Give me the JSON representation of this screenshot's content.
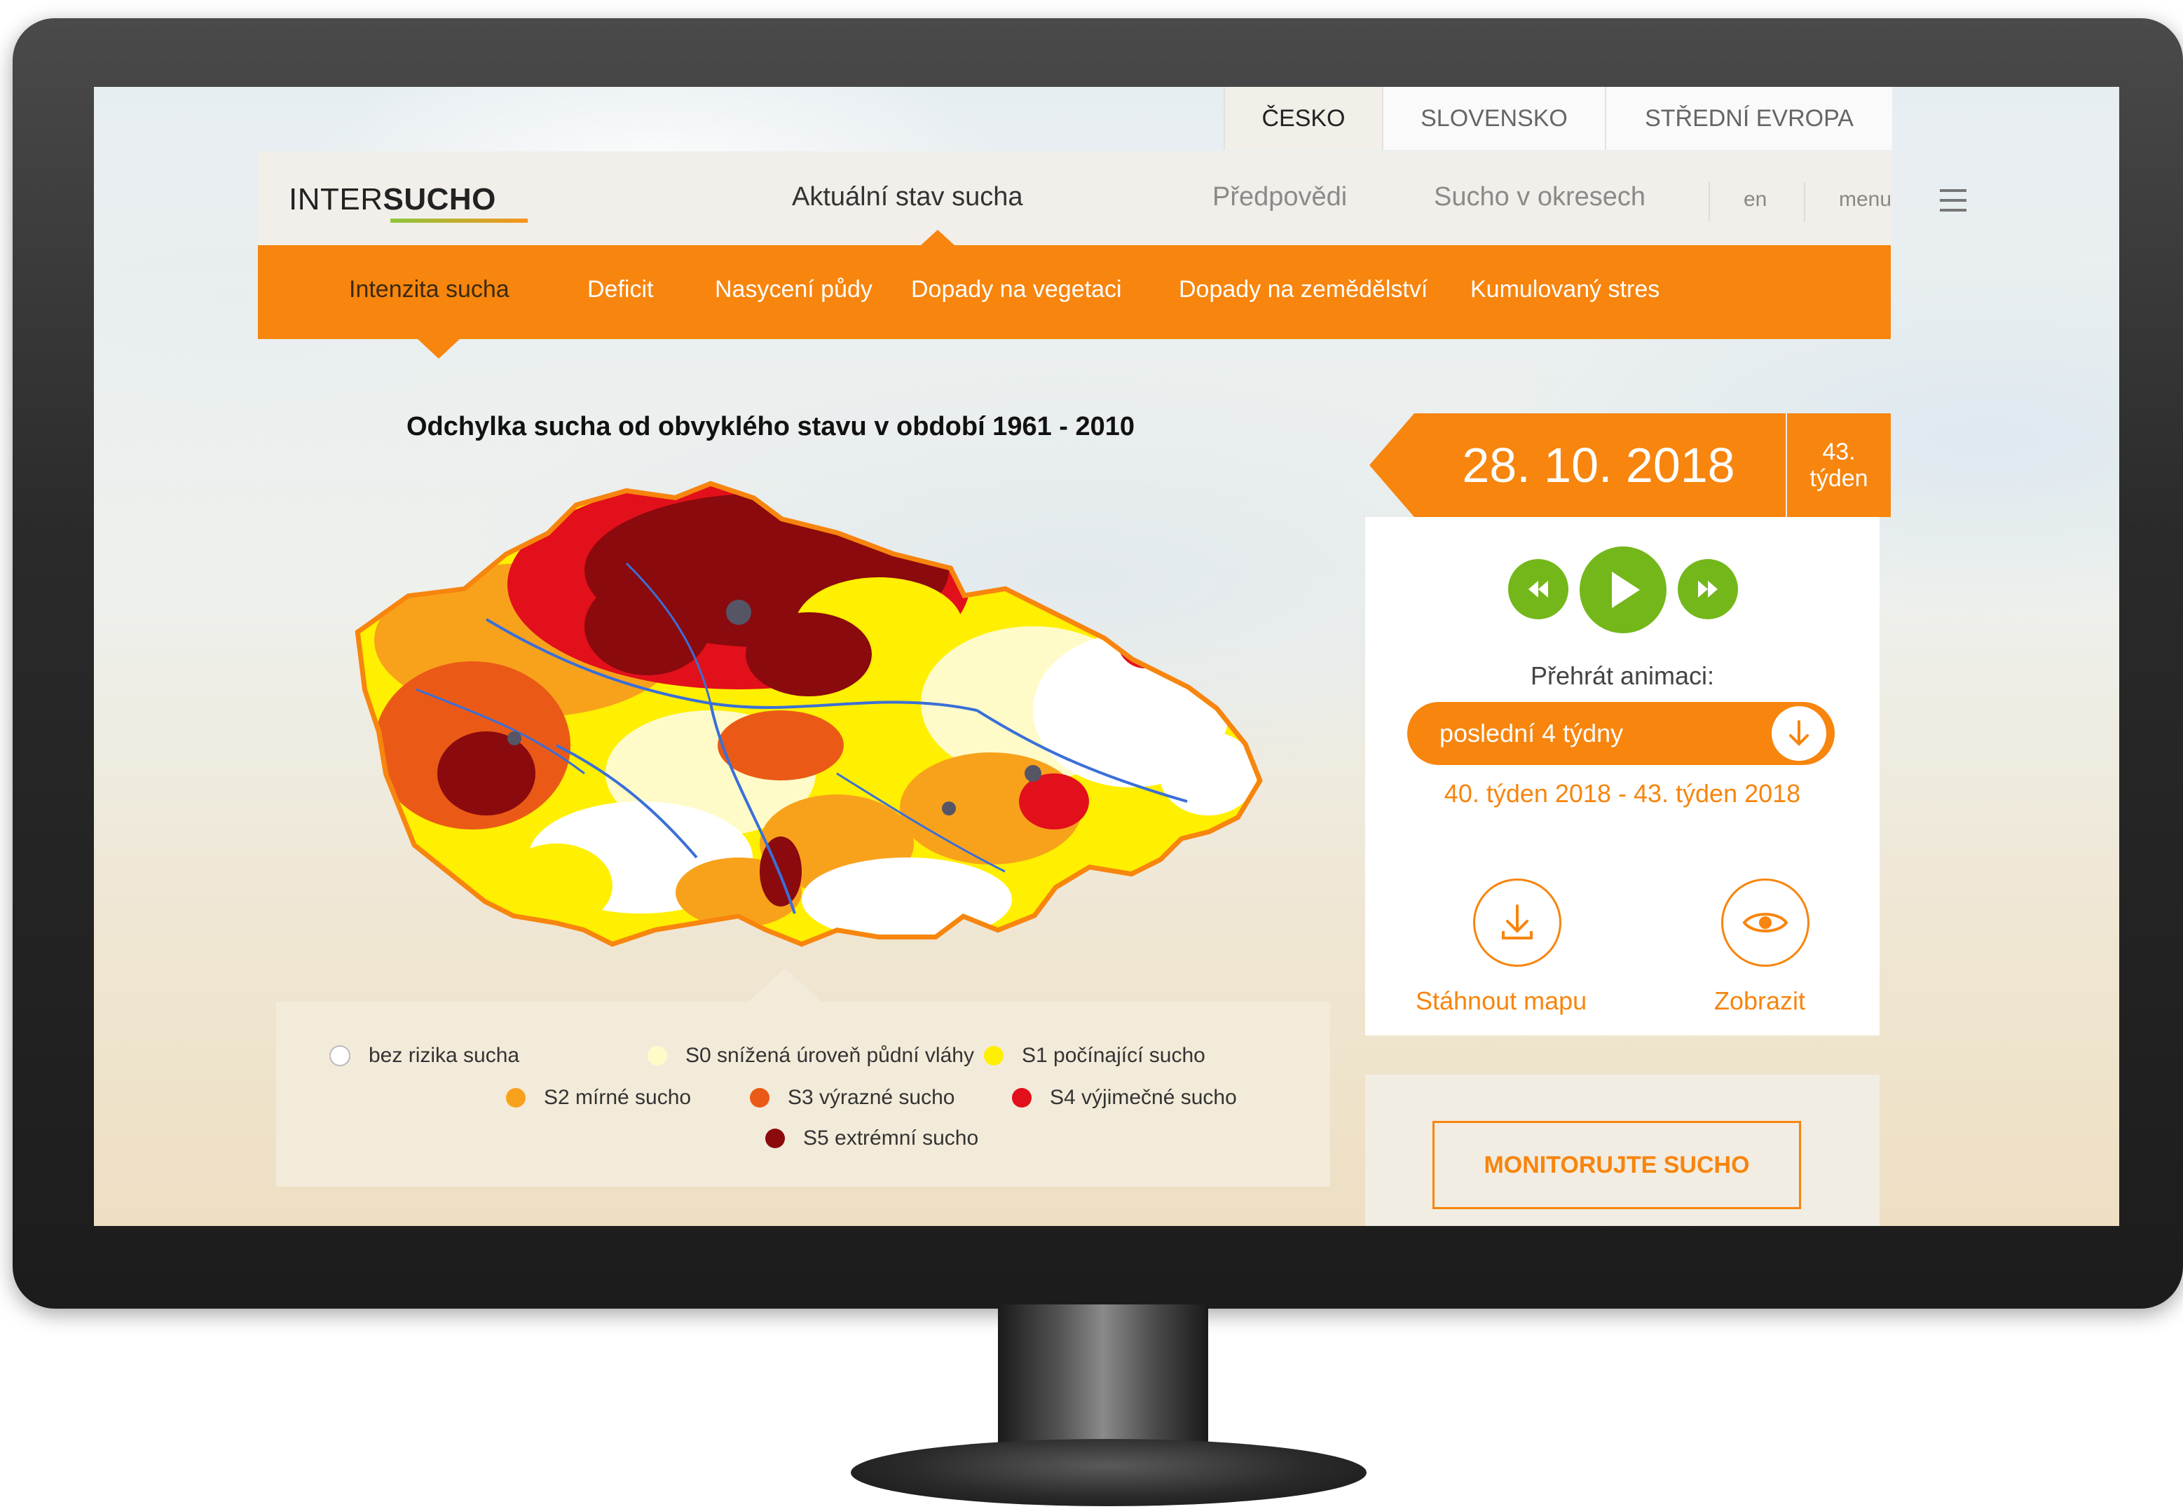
{
  "region_tabs": [
    {
      "label": "ČESKO",
      "active": true
    },
    {
      "label": "SLOVENSKO",
      "active": false
    },
    {
      "label": "STŘEDNÍ EVROPA",
      "active": false
    }
  ],
  "header": {
    "logo_plain": "INTER",
    "logo_bold": "SUCHO",
    "nav": [
      {
        "label": "Aktuální stav sucha",
        "active": true
      },
      {
        "label": "Předpovědi",
        "active": false
      },
      {
        "label": "Sucho v okresech",
        "active": false
      }
    ],
    "lang": "en",
    "menu_label": "menu"
  },
  "subnav": [
    {
      "label": "Intenzita sucha",
      "active": true
    },
    {
      "label": "Deficit"
    },
    {
      "label": "Nasycení půdy"
    },
    {
      "label": "Dopady na vegetaci"
    },
    {
      "label": "Dopady na zemědělství"
    },
    {
      "label": "Kumulovaný stres"
    }
  ],
  "map": {
    "title": "Odchylka sucha od obvyklého stavu v období 1961 - 2010"
  },
  "legend": [
    {
      "label": "bez rizika sucha",
      "color": "#ffffff"
    },
    {
      "label": "S0 snížená úroveň půdní vláhy",
      "color": "#fffbc8"
    },
    {
      "label": "S1 počínající sucho",
      "color": "#ffef00"
    },
    {
      "label": "S2 mírné sucho",
      "color": "#f8a21c"
    },
    {
      "label": "S3 výrazné sucho",
      "color": "#ea5a16"
    },
    {
      "label": "S4 výjimečné sucho",
      "color": "#e2101a"
    },
    {
      "label": "S5 extrémní sucho",
      "color": "#8a0a0e"
    }
  ],
  "date_panel": {
    "date": "28. 10. 2018",
    "week_number": "43.",
    "week_label": "týden"
  },
  "animation": {
    "label": "Přehrát animaci:",
    "selected_period": "poslední 4 týdny",
    "range": "40. týden 2018 - 43. týden 2018"
  },
  "actions": {
    "download_label": "Stáhnout mapu",
    "view_label": "Zobrazit"
  },
  "monitor_button": "MONITORUJTE SUCHO",
  "colors": {
    "accent": "#f7850e",
    "play_green": "#74b71b"
  }
}
